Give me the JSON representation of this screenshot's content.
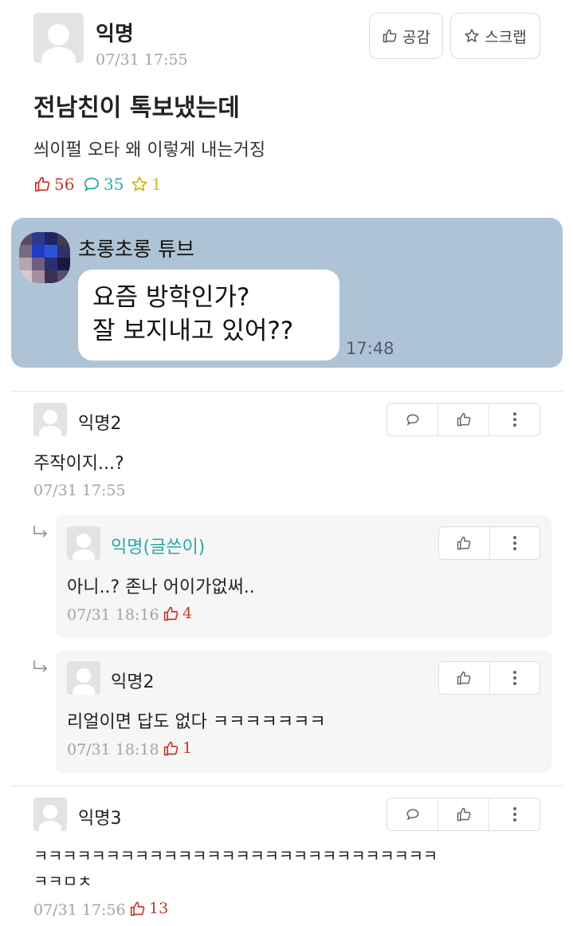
{
  "post": {
    "author": "익명",
    "date": "07/31 17:55",
    "buttons": {
      "like_label": "공감",
      "scrap_label": "스크랩"
    },
    "title": "전남친이 톡보냈는데",
    "body": "씌이펄 오타 왜 이렇게 내는거징",
    "stats": {
      "likes": "56",
      "comments": "35",
      "scraps": "1"
    },
    "colors": {
      "like": "#c0392b",
      "comment": "#2aa6a6",
      "scrap": "#d4b21c"
    }
  },
  "chat": {
    "sender": "초롱초롱 튜브",
    "message_line1": "요즘 방학인가?",
    "message_line2": "잘 보지내고 있어??",
    "time": "17:48",
    "background": "#aec4d6"
  },
  "comments": [
    {
      "author": "익명2",
      "text": "주작이지...?",
      "date": "07/31 17:55",
      "replies": [
        {
          "author": "익명(글쓴이)",
          "text": "아니..? 존나 어이가없써..",
          "date": "07/31 18:16",
          "likes": "4"
        },
        {
          "author": "익명2",
          "text": "리얼이면 답도 없다 ㅋㅋㅋㅋㅋㅋㅋ",
          "date": "07/31 18:18",
          "likes": "1"
        }
      ]
    },
    {
      "author": "익명3",
      "text_line1": "ㅋㅋㅋㅋㅋㅋㅋㅋㅋㅋㅋㅋㅋㅋㅋㅋㅋㅋㅋㅋㅋㅋㅋㅋㅋㅋㅋㅋ",
      "text_line2": "ㅋㅋㅁㅊ",
      "date": "07/31 17:56",
      "likes": "13"
    }
  ],
  "icons": {
    "like": "thumbs-up-icon",
    "comment": "speech-bubble-icon",
    "scrap": "star-icon",
    "more": "vertical-dots-icon",
    "reply": "reply-arrow-icon"
  }
}
